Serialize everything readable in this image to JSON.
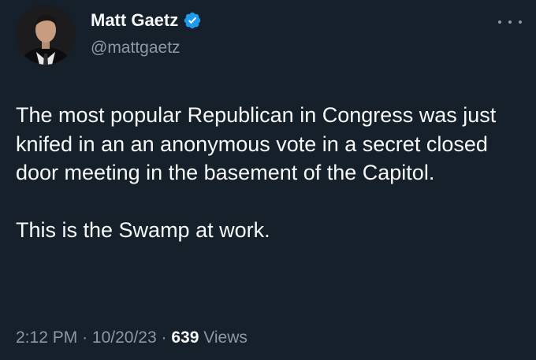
{
  "author": {
    "display_name": "Matt Gaetz",
    "handle": "@mattgaetz",
    "verified_icon": "verified-badge-icon"
  },
  "tweet": {
    "paragraphs": [
      "The most popular Republican in Congress was just knifed in an an anonymous vote in a secret closed door meeting in the basement of the Capitol.",
      "This is the Swamp at work."
    ],
    "time": "2:12 PM",
    "date": "10/20/23",
    "separator": "·",
    "views_count": "639",
    "views_label": "Views"
  },
  "colors": {
    "background": "#15202b",
    "text_primary": "#f7f9f9",
    "text_secondary": "#8b98a5",
    "verified_blue": "#1d9bf0"
  }
}
